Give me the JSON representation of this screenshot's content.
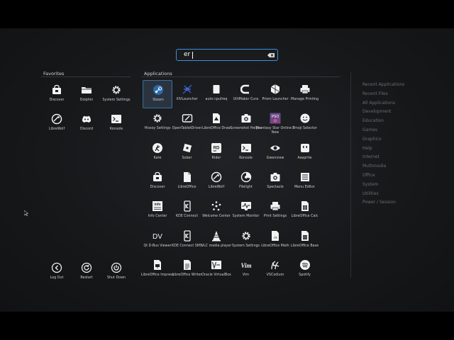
{
  "search": {
    "query": "er"
  },
  "favorites": {
    "title": "Favorites",
    "items": [
      {
        "label": "Discover",
        "icon": "discover-icon"
      },
      {
        "label": "Dolphin",
        "icon": "folder-icon"
      },
      {
        "label": "System Settings",
        "icon": "gear-icon"
      },
      {
        "label": "LibreWolf",
        "icon": "librewolf-icon"
      },
      {
        "label": "Discord",
        "icon": "discord-icon"
      },
      {
        "label": "Konsole",
        "icon": "terminal-icon"
      }
    ]
  },
  "power": [
    {
      "label": "Log Out",
      "icon": "logout-icon"
    },
    {
      "label": "Restart",
      "icon": "restart-icon"
    },
    {
      "label": "Shut Down",
      "icon": "power-icon"
    }
  ],
  "applications": {
    "title": "Applications",
    "items": [
      {
        "label": "Steam",
        "icon": "steam-icon"
      },
      {
        "label": "XIVLauncher",
        "icon": "xivlauncher-icon"
      },
      {
        "label": "auto-cpufreq",
        "icon": "blank-app-icon"
      },
      {
        "label": "UltiMaker Cura",
        "icon": "cura-icon"
      },
      {
        "label": "Prism Launcher",
        "icon": "prism-launcher-icon"
      },
      {
        "label": "Manage Printing",
        "icon": "printer-icon"
      },
      {
        "label": "Hissoy Settings",
        "icon": "gear-icon"
      },
      {
        "label": "OpenTabletDriver",
        "icon": "tablet-icon"
      },
      {
        "label": "LibreOffice Draw",
        "icon": "draw-icon"
      },
      {
        "label": "Screenshot Helper",
        "icon": "camera-icon"
      },
      {
        "label": "Phantasy Star Online 2 New",
        "icon": "pso2-icon"
      },
      {
        "label": "Emoji Selector",
        "icon": "emoji-icon"
      },
      {
        "label": "Kate",
        "icon": "kate-icon"
      },
      {
        "label": "Sober",
        "icon": "sober-icon"
      },
      {
        "label": "Rider",
        "icon": "rider-icon"
      },
      {
        "label": "Konsole",
        "icon": "terminal-icon"
      },
      {
        "label": "Gwenview",
        "icon": "eye-icon"
      },
      {
        "label": "Aseprite",
        "icon": "aseprite-icon"
      },
      {
        "label": "Discover",
        "icon": "discover-icon"
      },
      {
        "label": "LibreOffice",
        "icon": "libreoffice-icon"
      },
      {
        "label": "LibreWolf",
        "icon": "librewolf-icon"
      },
      {
        "label": "Filelight",
        "icon": "filelight-icon"
      },
      {
        "label": "Spectacle",
        "icon": "camera-icon"
      },
      {
        "label": "Menu Editor",
        "icon": "menu-editor-icon"
      },
      {
        "label": "Info Center",
        "icon": "info-icon"
      },
      {
        "label": "KDE Connect",
        "icon": "kde-connect-icon"
      },
      {
        "label": "Welcome Center",
        "icon": "welcome-icon"
      },
      {
        "label": "System Monitor",
        "icon": "monitor-icon"
      },
      {
        "label": "Print Settings",
        "icon": "printer-icon"
      },
      {
        "label": "LibreOffice Calc",
        "icon": "calc-icon"
      },
      {
        "label": "Qt D-Bus Viewer",
        "icon": "dv-icon"
      },
      {
        "label": "KDE Connect SMS",
        "icon": "kde-connect-icon"
      },
      {
        "label": "VLC media player",
        "icon": "vlc-icon"
      },
      {
        "label": "System Settings",
        "icon": "gear-icon"
      },
      {
        "label": "LibreOffice Math",
        "icon": "math-icon"
      },
      {
        "label": "LibreOffice Base",
        "icon": "base-icon"
      },
      {
        "label": "LibreOffice Impress",
        "icon": "impress-icon"
      },
      {
        "label": "LibreOffice Writer",
        "icon": "writer-icon"
      },
      {
        "label": "Oracle VirtualBox",
        "icon": "virtualbox-icon"
      },
      {
        "label": "Vim",
        "icon": "vim-icon"
      },
      {
        "label": "VSCodium",
        "icon": "vscodium-icon"
      },
      {
        "label": "Spotify",
        "icon": "spotify-icon"
      }
    ]
  },
  "categories": [
    "Recent Applications",
    "Recent Files",
    "All Applications",
    "Development",
    "Education",
    "Games",
    "Graphics",
    "Help",
    "Internet",
    "Multimedia",
    "Office",
    "System",
    "Utilities",
    "Power / Session"
  ],
  "colors": {
    "accent": "#3d8ee0",
    "background": "#17181a"
  }
}
